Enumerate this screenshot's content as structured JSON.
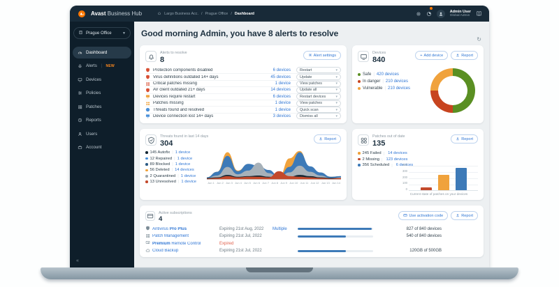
{
  "topbar": {
    "brand_bold": "Avast",
    "brand_rest": " Business Hub",
    "breadcrumb": [
      "Largo Business Acc.",
      "Prague Office",
      "Dashboard"
    ],
    "user_name": "Admin User",
    "user_role": "Global Admin"
  },
  "sidebar": {
    "org_selector": "Prague Office",
    "collapse_glyph": "«",
    "items": [
      {
        "label": "Dashboard",
        "icon": "dashboard",
        "active": true
      },
      {
        "label": "Alerts",
        "icon": "alerts",
        "badge": "NEW"
      },
      {
        "label": "Devices",
        "icon": "devices"
      },
      {
        "label": "Policies",
        "icon": "policies"
      },
      {
        "label": "Patches",
        "icon": "patches"
      },
      {
        "label": "Reports",
        "icon": "reports"
      },
      {
        "label": "Users",
        "icon": "users"
      },
      {
        "label": "Account",
        "icon": "account"
      }
    ]
  },
  "main": {
    "greeting": "Good morning Admin, you have 8 alerts to resolve",
    "alerts_card": {
      "title": "Alerts to resolve",
      "count": "8",
      "settings_button": "Alert settings",
      "rows": [
        {
          "icon": "shield",
          "color": "#d84f33",
          "label": "Protection components disabled",
          "devices": "6 devices",
          "action": "Restart"
        },
        {
          "icon": "shield",
          "color": "#d84f33",
          "label": "Virus definitions outdated 14+ days",
          "devices": "45 devices",
          "action": "Update"
        },
        {
          "icon": "grid",
          "color": "#d84f33",
          "label": "Critical patches missing",
          "devices": "1 device",
          "action": "View patches"
        },
        {
          "icon": "shield",
          "color": "#d84f33",
          "label": "AV client outdated 21+ days",
          "devices": "14 devices",
          "action": "Update all"
        },
        {
          "icon": "monitor",
          "color": "#f0a23c",
          "label": "Devices require restart",
          "devices": "6 devices",
          "action": "Restart devices"
        },
        {
          "icon": "grid",
          "color": "#f0a23c",
          "label": "Patches missing",
          "devices": "1 device",
          "action": "View patches"
        },
        {
          "icon": "circle",
          "color": "#4a90d9",
          "label": "Threats found and resolved",
          "devices": "1 device",
          "action": "Quick scan"
        },
        {
          "icon": "monitor",
          "color": "#4a90d9",
          "label": "Device connection lost 14+ days",
          "devices": "3 devices",
          "action": "Dismiss all"
        }
      ]
    },
    "devices_card": {
      "title": "Devices",
      "count": "840",
      "add_button": "Add device",
      "report_button": "Report",
      "legend": [
        {
          "name": "Safe",
          "devices": "420 devices",
          "color": "#5a8f22"
        },
        {
          "name": "In danger",
          "devices": "210 devices",
          "color": "#c7441f"
        },
        {
          "name": "Vulnerable",
          "devices": "210 devices",
          "color": "#f0a23c"
        }
      ]
    },
    "threats_card": {
      "title": "Threats found in last 14 days",
      "count": "304",
      "report_button": "Report",
      "legend": [
        {
          "count": "145",
          "name": "Autofix",
          "devices": "1 device",
          "color": "#142633"
        },
        {
          "count": "12",
          "name": "Repaired",
          "devices": "1 device",
          "color": "#4a90d9"
        },
        {
          "count": "89",
          "name": "Blocked",
          "devices": "1 device",
          "color": "#2c5a84"
        },
        {
          "count": "56",
          "name": "Deleted",
          "devices": "14 devices",
          "color": "#f0a23c"
        },
        {
          "count": "2",
          "name": "Quarantined",
          "devices": "1 device",
          "color": "#9aa5ad"
        },
        {
          "count": "13",
          "name": "Unresolved",
          "devices": "1 device",
          "color": "#c3492b"
        }
      ]
    },
    "patches_card": {
      "title": "Patches out of date",
      "count": "135",
      "report_button": "Report",
      "legend": [
        {
          "count": "245",
          "name": "Failed",
          "devices": "14 devices",
          "color": "#f0a23c"
        },
        {
          "count": "2",
          "name": "Missing",
          "devices": "123 devices",
          "color": "#c3492b"
        },
        {
          "count": "356",
          "name": "Scheduled",
          "devices": "6 devices",
          "color": "#3d7ab8"
        }
      ],
      "caption": "Current state of patches on your devices"
    },
    "subscriptions_card": {
      "title": "Active subscriptions",
      "count": "4",
      "activation_button": "Use activation code",
      "report_button": "Report",
      "rows": [
        {
          "icon": "shield",
          "pre": "Antivirus ",
          "bold": "Pro Plus",
          "post": "",
          "expiry": "Expiring 21st Aug, 2022",
          "expired": false,
          "extra": "Multiple",
          "percent": 98,
          "value": "827 of 840 devices"
        },
        {
          "icon": "grid",
          "pre": "Patch Management",
          "bold": "",
          "post": "",
          "expiry": "Expiring 21st Jul, 2022",
          "expired": false,
          "extra": "",
          "percent": 64,
          "value": "540 of 840 devices"
        },
        {
          "icon": "remote",
          "pre": "",
          "bold": "Premium",
          "post": " Remote Control",
          "expiry": "Expired",
          "expired": true,
          "extra": "",
          "percent": null,
          "value": ""
        },
        {
          "icon": "cloud",
          "pre": "Cloud Backup",
          "bold": "",
          "post": "",
          "expiry": "Expiring 21st Jul, 2022",
          "expired": false,
          "extra": "",
          "percent": 64,
          "value": "120GB of 500GB"
        }
      ]
    }
  },
  "chart_data": [
    {
      "type": "pie",
      "subtype": "donut",
      "title": "Devices",
      "total": 840,
      "slices": [
        {
          "label": "Safe",
          "value": 420,
          "color": "#5a8f22"
        },
        {
          "label": "In danger",
          "value": 210,
          "color": "#c7441f"
        },
        {
          "label": "Vulnerable",
          "value": 210,
          "color": "#f0a23c"
        }
      ],
      "legend_position": "left"
    },
    {
      "type": "area",
      "subtype": "stacked",
      "title": "Threats found in last 14 days",
      "total": 304,
      "x": [
        "Jun 1",
        "Jun 2",
        "Jun 3",
        "Jun 4",
        "Jun 5",
        "Jun 6",
        "Jun 7",
        "Jun 8",
        "Jun 9",
        "Jun 10",
        "Jun 11",
        "Jun 12",
        "Jun 13",
        "Jun 14"
      ],
      "series_totals": [
        {
          "name": "Autofix",
          "value": 145
        },
        {
          "name": "Repaired",
          "value": 12
        },
        {
          "name": "Blocked",
          "value": 89
        },
        {
          "name": "Deleted",
          "value": 56
        },
        {
          "name": "Quarantined",
          "value": 2
        },
        {
          "name": "Unresolved",
          "value": 13
        }
      ],
      "estimated_layer_envelopes": [
        {
          "name": "Deleted",
          "color": "#f0a23c",
          "heights": [
            3,
            12,
            44,
            14,
            24,
            20,
            14,
            4,
            34,
            46,
            18,
            10,
            4,
            5
          ]
        },
        {
          "name": "Autofix",
          "color": "#3d7ab8",
          "heights": [
            3,
            12,
            38,
            13,
            25,
            22,
            15,
            4,
            20,
            44,
            21,
            11,
            4,
            5
          ]
        },
        {
          "name": "Quarantined",
          "color": "#a7b1b9",
          "heights": [
            2,
            6,
            20,
            8,
            14,
            27,
            10,
            3,
            11,
            22,
            12,
            6,
            2,
            3
          ]
        },
        {
          "name": "Blocked",
          "color": "#142633",
          "heights": [
            2,
            3,
            7,
            4,
            5,
            6,
            4,
            2,
            4,
            7,
            5,
            3,
            2,
            2
          ]
        },
        {
          "name": "Unresolved",
          "color": "#c3492b",
          "heights": [
            1,
            2,
            5,
            3,
            4,
            4,
            3,
            13,
            5,
            4,
            3,
            2,
            1,
            2
          ]
        }
      ],
      "y_axis": "hidden",
      "legend_position": "left"
    },
    {
      "type": "bar",
      "title": "Patches out of date",
      "categories": [
        "Missing",
        "Failed",
        "Scheduled"
      ],
      "values": [
        2,
        245,
        356
      ],
      "colors": [
        "#c3492b",
        "#f0a23c",
        "#3d7ab8"
      ],
      "yticks": [
        0,
        100,
        200,
        300,
        400
      ],
      "ylim": [
        0,
        400
      ],
      "xlabel": "Current state of patches on your devices",
      "grid": true
    }
  ]
}
